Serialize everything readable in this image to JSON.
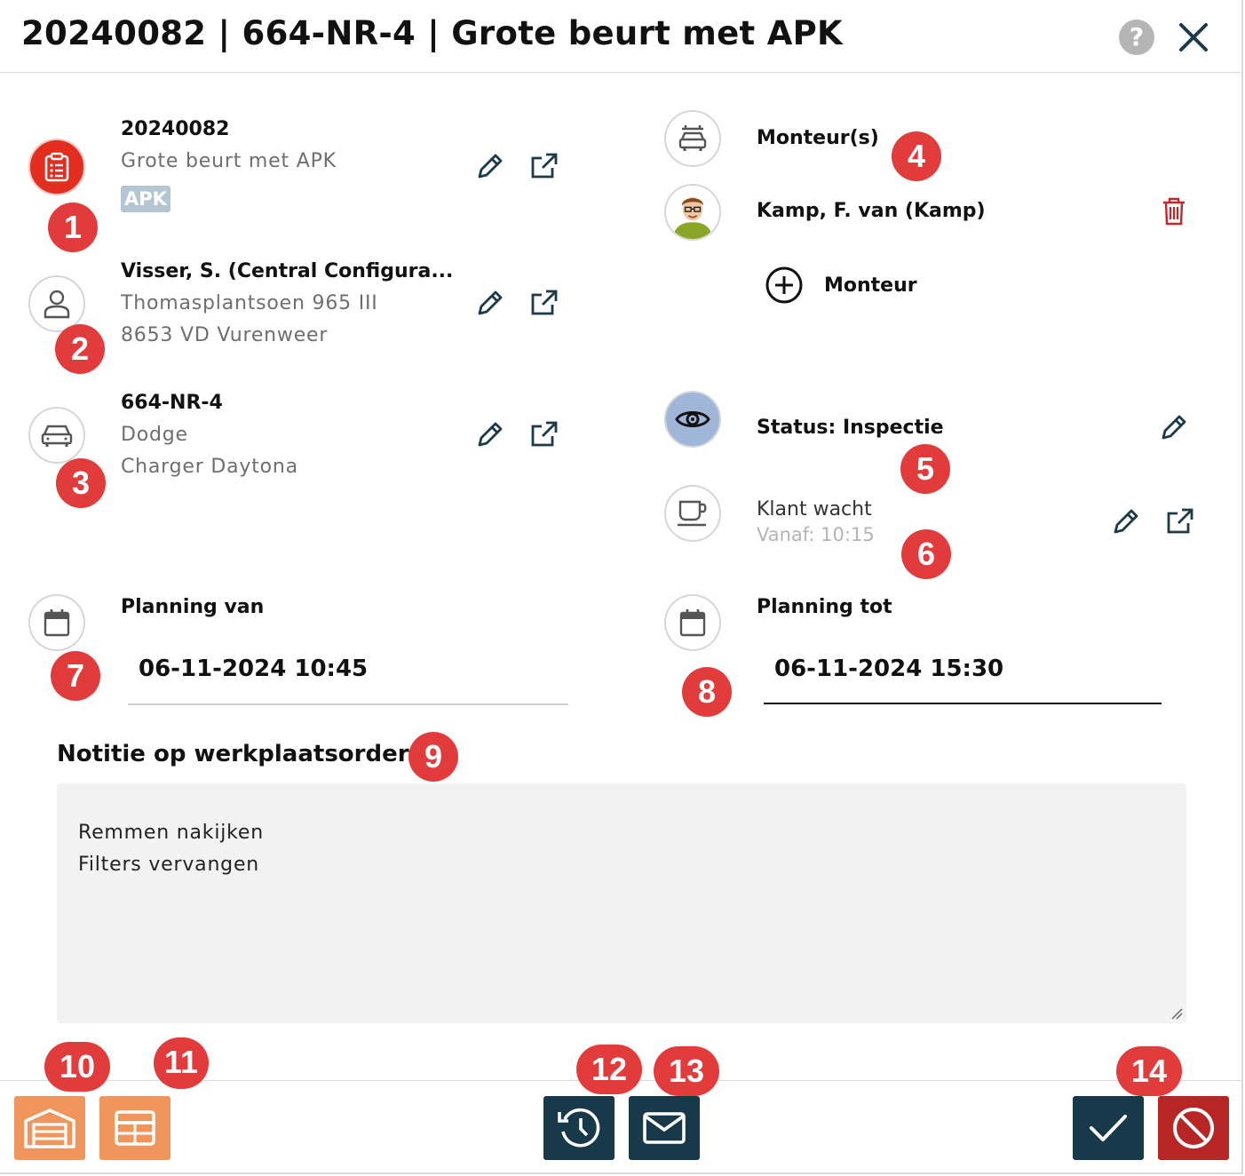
{
  "header": {
    "title": "20240082 | 664-NR-4 | Grote beurt met APK",
    "help_label": "?"
  },
  "order": {
    "number": "20240082",
    "description": "Grote beurt met APK",
    "tag": "APK"
  },
  "customer": {
    "name": "Visser, S. (Central Configura...",
    "street": "Thomasplantsoen 965 III",
    "city": "8653 VD Vurenweer"
  },
  "vehicle": {
    "plate": "664-NR-4",
    "make": "Dodge",
    "model": "Charger Daytona"
  },
  "mechanics": {
    "title": "Monteur(s)",
    "items": [
      {
        "name": "Kamp, F. van (Kamp)"
      }
    ],
    "add_label": "Monteur"
  },
  "status": {
    "label": "Status: Inspectie"
  },
  "waiting": {
    "label": "Klant wacht",
    "since": "Vanaf: 10:15"
  },
  "planning": {
    "from_label": "Planning van",
    "from_value": "06-11-2024 10:45",
    "to_label": "Planning tot",
    "to_value": "06-11-2024 15:30"
  },
  "notes": {
    "title": "Notitie op werkplaatsorder",
    "lines": [
      "Remmen nakijken",
      "Filters vervangen"
    ]
  },
  "badges": [
    "1",
    "2",
    "3",
    "4",
    "5",
    "6",
    "7",
    "8",
    "9",
    "10",
    "11",
    "12",
    "13",
    "14"
  ],
  "colors": {
    "accent_red": "#e32d1f",
    "badge_red": "#e13b3b",
    "orange": "#f0955b",
    "navy": "#17394a",
    "cancel_red": "#b72525",
    "tag_blue": "#b4c5d4",
    "status_blue": "#9fb6d9"
  },
  "icons": {
    "order": "clipboard-icon",
    "customer": "user-icon",
    "vehicle": "car-icon",
    "mechanic": "mechanic-car-icon",
    "status": "eye-icon",
    "waiting": "coffee-cup-icon",
    "calendar": "calendar-icon",
    "edit": "pencil-icon",
    "open": "external-link-icon",
    "delete": "trash-icon",
    "add": "plus-circle-icon",
    "garage": "garage-icon",
    "table": "table-icon",
    "history": "history-icon",
    "mail": "mail-icon",
    "confirm": "check-icon",
    "cancel": "ban-icon"
  }
}
